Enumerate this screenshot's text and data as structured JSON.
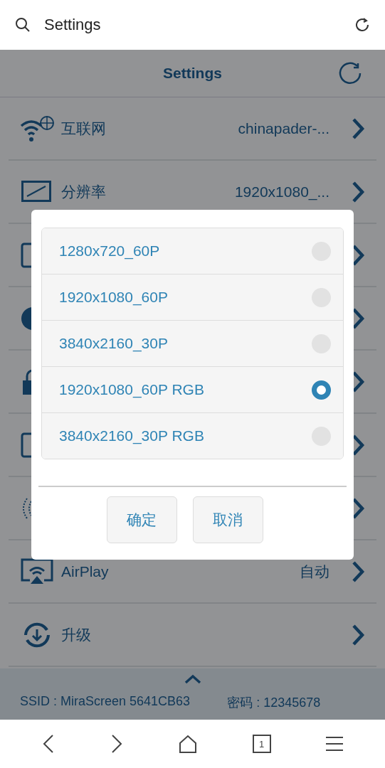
{
  "browser": {
    "title": "Settings"
  },
  "page": {
    "title": "Settings"
  },
  "rows": [
    {
      "kind": "item",
      "label": "互联网",
      "value": "chinapader-..."
    },
    {
      "kind": "item",
      "label": "分辨率",
      "value": "1920x1080_..."
    },
    {
      "kind": "covered"
    },
    {
      "kind": "covered"
    },
    {
      "kind": "covered"
    },
    {
      "kind": "covered"
    },
    {
      "kind": "covered"
    },
    {
      "kind": "item",
      "label": "AirPlay",
      "value": "自动"
    },
    {
      "kind": "item",
      "label": "升级"
    }
  ],
  "footer": {
    "ssid": "SSID : MiraScreen 5641CB63",
    "password": "密码 : 12345678"
  },
  "dialog": {
    "options": [
      {
        "label": "1280x720_60P",
        "selected": false
      },
      {
        "label": "1920x1080_60P",
        "selected": false
      },
      {
        "label": "3840x2160_30P",
        "selected": false
      },
      {
        "label": "1920x1080_60P RGB",
        "selected": true
      },
      {
        "label": "3840x2160_30P RGB",
        "selected": false
      }
    ],
    "buttons": [
      "确定",
      "取消"
    ]
  },
  "nav": {
    "tab_count": "1"
  }
}
